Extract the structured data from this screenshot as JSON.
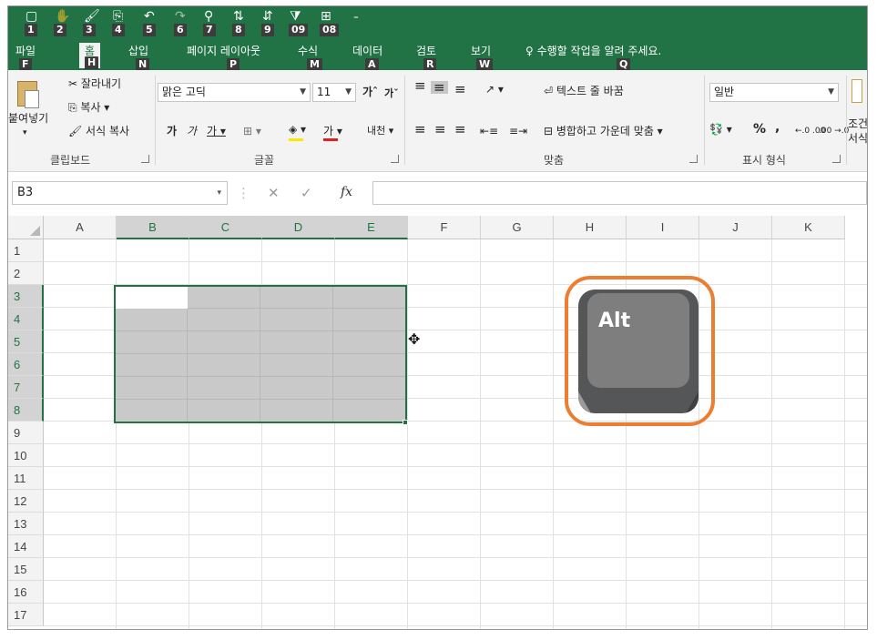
{
  "theme": {
    "accent": "#217346",
    "ribbon_bg": "#f3f3f3",
    "keytip_bg": "#3c3c3c",
    "highlight_ring": "#ed7d31",
    "selection_fill": "#c9c9c9"
  },
  "qat": [
    {
      "icon": "save-icon",
      "glyph": "▢",
      "keytip": "1"
    },
    {
      "icon": "touch-mode-icon",
      "glyph": "✋",
      "keytip": "2"
    },
    {
      "icon": "format-painter-icon",
      "glyph": "🖌",
      "keytip": "3"
    },
    {
      "icon": "screenshot-icon",
      "glyph": "⎘",
      "keytip": "4"
    },
    {
      "icon": "undo-icon",
      "glyph": "↶",
      "keytip": "5"
    },
    {
      "icon": "redo-icon",
      "glyph": "↷",
      "keytip": "6"
    },
    {
      "icon": "find-icon",
      "glyph": "⚲",
      "keytip": "7"
    },
    {
      "icon": "sort-icon",
      "glyph": "⇅",
      "keytip": "8"
    },
    {
      "icon": "sort-desc-icon",
      "glyph": "⇵",
      "keytip": "9"
    },
    {
      "icon": "filter-icon",
      "glyph": "⧩",
      "keytip": "09"
    },
    {
      "icon": "table-icon",
      "glyph": "⊞",
      "keytip": "08"
    }
  ],
  "qat_more": "₌",
  "tabs": [
    {
      "id": "file",
      "label": "파일",
      "keytip": "F"
    },
    {
      "id": "home",
      "label": "홈",
      "keytip": "H"
    },
    {
      "id": "insert",
      "label": "삽입",
      "keytip": "N"
    },
    {
      "id": "page-layout",
      "label": "페이지 레이아웃",
      "keytip": "P"
    },
    {
      "id": "formulas",
      "label": "수식",
      "keytip": "M"
    },
    {
      "id": "data",
      "label": "데이터",
      "keytip": "A"
    },
    {
      "id": "review",
      "label": "검토",
      "keytip": "R"
    },
    {
      "id": "view",
      "label": "보기",
      "keytip": "W"
    },
    {
      "id": "tell-me",
      "label": "♀ 수행할 작업을 알려 주세요.",
      "keytip": "Q"
    }
  ],
  "ribbon": {
    "paste_label_1": "붙여넣기",
    "paste_arrow": "▾",
    "cut": "✂ 잘라내기",
    "copy": "⎘ 복사 ▾",
    "format_painter": "🖌 서식 복사",
    "clipboard_group": "클립보드",
    "font_name": "맑은 고딕",
    "font_size": "11",
    "grow_font": "가ˆ",
    "shrink_font": "가ˇ",
    "bold": "가",
    "italic": "가",
    "underline": "가 ▾",
    "border": "⊞ ▾",
    "fill_color": "◈ ▾",
    "font_color": "가 ▾",
    "phonetic": "내천 ▾",
    "font_group": "글꼴",
    "align_top": "≡",
    "align_middle": "≡",
    "align_bottom": "≡",
    "orientation": "↗ ▾",
    "align_left": "≡",
    "align_center": "≡",
    "align_right": "≡",
    "outdent": "⇤≡",
    "indent": "≡⇥",
    "wrap_text": "⏎ 텍스트 줄 바꿈",
    "merge_center": "⊟ 병합하고 가운데 맞춤 ▾",
    "alignment_group": "맞춤",
    "number_format": "일반",
    "currency": "💱 ▾",
    "percent": "%",
    "comma": ",",
    "inc_decimal": "←.0 .00",
    "dec_decimal": ".00 →.0",
    "number_group": "표시 형식",
    "conditional_1": "조건",
    "conditional_2": "서식"
  },
  "formula_bar": {
    "name_box": "B3",
    "name_arrow": "▾",
    "divider": "⋮",
    "cancel": "✕",
    "enter": "✓",
    "fx": "fx",
    "value": ""
  },
  "columns": [
    "A",
    "B",
    "C",
    "D",
    "E",
    "F",
    "G",
    "H",
    "I",
    "J",
    "K"
  ],
  "selected_columns": [
    "B",
    "C",
    "D",
    "E"
  ],
  "rows": [
    "1",
    "2",
    "3",
    "4",
    "5",
    "6",
    "7",
    "8",
    "9",
    "10",
    "11",
    "12",
    "13",
    "14",
    "15",
    "16",
    "17"
  ],
  "selected_rows": [
    "3",
    "4",
    "5",
    "6",
    "7",
    "8"
  ],
  "selection": {
    "range": "B3:E8",
    "active_cell": "B3"
  },
  "cursor_icon": "✥",
  "overlay_key": {
    "label": "Alt",
    "icon": "alt-key-icon"
  }
}
